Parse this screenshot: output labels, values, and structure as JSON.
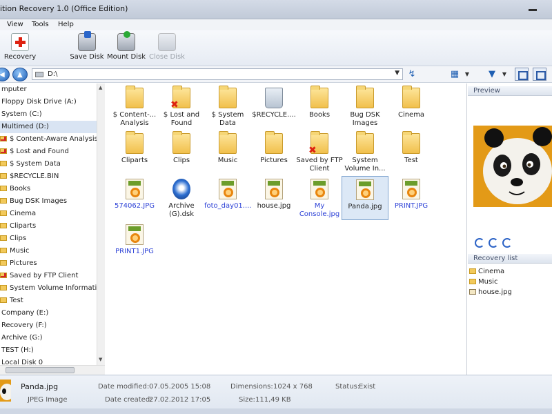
{
  "window": {
    "title": "ition Recovery 1.0 (Office Edition)"
  },
  "menu": [
    "View",
    "Tools",
    "Help"
  ],
  "toolbar": {
    "recovery": "Recovery",
    "save_disk": "Save Disk",
    "mount_disk": "Mount Disk",
    "close_disk": "Close Disk"
  },
  "address": {
    "path": "D:\\"
  },
  "tree": [
    {
      "label": "mputer",
      "level": 0
    },
    {
      "label": "Floppy Disk Drive (A:)",
      "level": 1
    },
    {
      "label": "System (C:)",
      "level": 1
    },
    {
      "label": "Multimed (D:)",
      "level": 1,
      "selected": true
    },
    {
      "label": "$ Content-Aware Analysis",
      "level": 2,
      "icon": "deleted-folder"
    },
    {
      "label": "$ Lost and Found",
      "level": 2,
      "icon": "deleted-folder"
    },
    {
      "label": "$ System Data",
      "level": 2,
      "icon": "folder"
    },
    {
      "label": "$RECYCLE.BIN",
      "level": 2,
      "icon": "folder"
    },
    {
      "label": "Books",
      "level": 2,
      "icon": "folder"
    },
    {
      "label": "Bug DSK Images",
      "level": 2,
      "icon": "folder"
    },
    {
      "label": "Cinema",
      "level": 2,
      "icon": "folder"
    },
    {
      "label": "Cliparts",
      "level": 2,
      "icon": "folder"
    },
    {
      "label": "Clips",
      "level": 2,
      "icon": "folder"
    },
    {
      "label": "Music",
      "level": 2,
      "icon": "folder"
    },
    {
      "label": "Pictures",
      "level": 2,
      "icon": "folder"
    },
    {
      "label": "Saved by FTP Client",
      "level": 2,
      "icon": "deleted-folder"
    },
    {
      "label": "System Volume Informati",
      "level": 2,
      "icon": "folder"
    },
    {
      "label": "Test",
      "level": 2,
      "icon": "folder"
    },
    {
      "label": "Company (E:)",
      "level": 1
    },
    {
      "label": "Recovery (F:)",
      "level": 1
    },
    {
      "label": "Archive (G:)",
      "level": 1
    },
    {
      "label": "TEST (H:)",
      "level": 1
    },
    {
      "label": "Local Disk 0",
      "level": 1
    }
  ],
  "files": [
    {
      "label": "$ Content-... Analysis",
      "icon": "folder"
    },
    {
      "label": "$ Lost and Found",
      "icon": "deleted-folder"
    },
    {
      "label": "$ System Data",
      "icon": "folder"
    },
    {
      "label": "$RECYCLE....",
      "icon": "recycle-bin"
    },
    {
      "label": "Books",
      "icon": "folder"
    },
    {
      "label": "Bug DSK Images",
      "icon": "folder"
    },
    {
      "label": "Cinema",
      "icon": "folder"
    },
    {
      "label": "Cliparts",
      "icon": "folder"
    },
    {
      "label": "Clips",
      "icon": "folder"
    },
    {
      "label": "Music",
      "icon": "folder"
    },
    {
      "label": "Pictures",
      "icon": "folder"
    },
    {
      "label": "Saved by FTP Client",
      "icon": "deleted-folder"
    },
    {
      "label": "System Volume In...",
      "icon": "folder"
    },
    {
      "label": "Test",
      "icon": "folder"
    },
    {
      "label": "574062.JPG",
      "icon": "jpeg",
      "deleted": true
    },
    {
      "label": "Archive (G).dsk",
      "icon": "disk-image"
    },
    {
      "label": "foto_day01....",
      "icon": "jpeg",
      "deleted": true
    },
    {
      "label": "house.jpg",
      "icon": "jpeg"
    },
    {
      "label": "My Console.jpg",
      "icon": "jpeg",
      "deleted": true
    },
    {
      "label": "Panda.jpg",
      "icon": "jpeg",
      "selected": true
    },
    {
      "label": "PRINT.JPG",
      "icon": "jpeg",
      "deleted": true
    },
    {
      "label": "PRINT1.JPG",
      "icon": "jpeg",
      "deleted": true
    }
  ],
  "preview": {
    "title": "Preview"
  },
  "recovery_list": {
    "title": "Recovery list",
    "items": [
      {
        "label": "Cinema",
        "icon": "folder"
      },
      {
        "label": "Music",
        "icon": "folder"
      },
      {
        "label": "house.jpg",
        "icon": "jpeg"
      }
    ]
  },
  "status": {
    "name": "Panda.jpg",
    "type": "JPEG Image",
    "modified_label": "Date modified:",
    "modified": "07.05.2005 15:08",
    "created_label": "Date created:",
    "created": "27.02.2012 17:05",
    "dims_label": "Dimensions:",
    "dims": "1024 x 768",
    "size_label": "Size:",
    "size": "111,49 KB",
    "status_label": "Status:",
    "status": "Exist"
  },
  "colors": {
    "deleted_text": "#2a3fd6",
    "selection": "#dce8f6",
    "folder": "#f1c04c",
    "accent": "#1e5fb6"
  }
}
